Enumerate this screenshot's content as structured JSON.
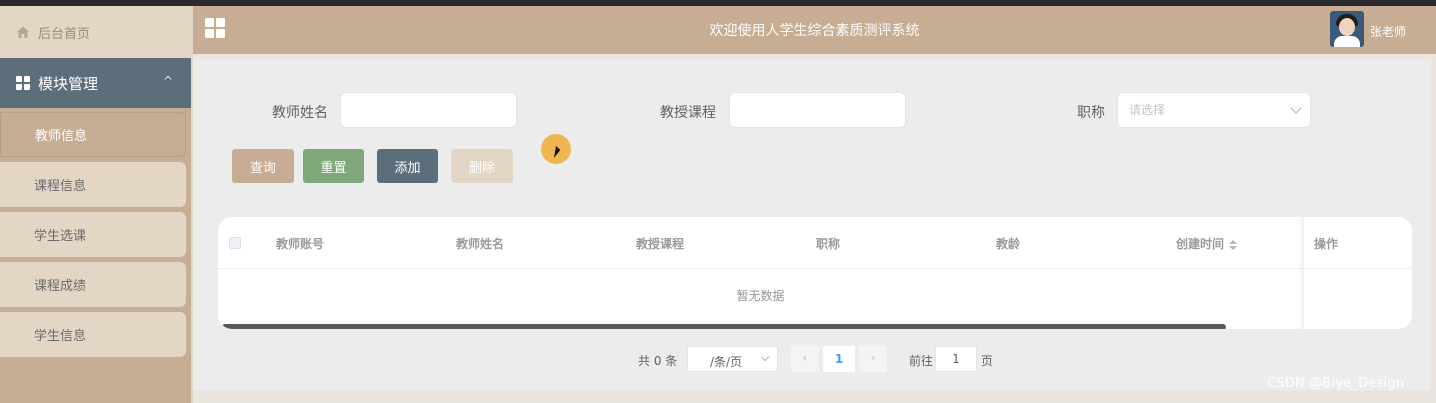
{
  "header": {
    "title": "欢迎使用人学生综合素质测评系统",
    "username": "张老师"
  },
  "sidebar": {
    "home_label": "后台首页",
    "module_label": "模块管理",
    "module_chevron": "^",
    "items": [
      {
        "label": "教师信息",
        "active": true
      },
      {
        "label": "课程信息"
      },
      {
        "label": "学生选课"
      },
      {
        "label": "课程成绩"
      },
      {
        "label": "学生信息"
      }
    ]
  },
  "filters": {
    "teacher_name_label": "教师姓名",
    "teacher_name_value": "",
    "course_label": "教授课程",
    "course_value": "",
    "title_label": "职称",
    "title_placeholder": "请选择"
  },
  "buttons": {
    "search": "查询",
    "reset": "重置",
    "add": "添加",
    "delete": "删除"
  },
  "colors": {
    "search_btn": "#c6ad94",
    "reset_btn": "#7ea77a",
    "add_btn": "#5d6e7b",
    "delete_btn": "#e3d6c5"
  },
  "table": {
    "columns": [
      "教师账号",
      "教师姓名",
      "教授课程",
      "职称",
      "教龄",
      "创建时间",
      "操作"
    ],
    "empty_text": "暂无数据"
  },
  "pagination": {
    "total_text": "共 0 条",
    "page_size": "/条/页",
    "prev": "‹",
    "current": "1",
    "next": "›",
    "goto_label": "前往",
    "goto_value": "1",
    "page_suffix": "页"
  },
  "watermark": "CSDN @Biye_Design"
}
